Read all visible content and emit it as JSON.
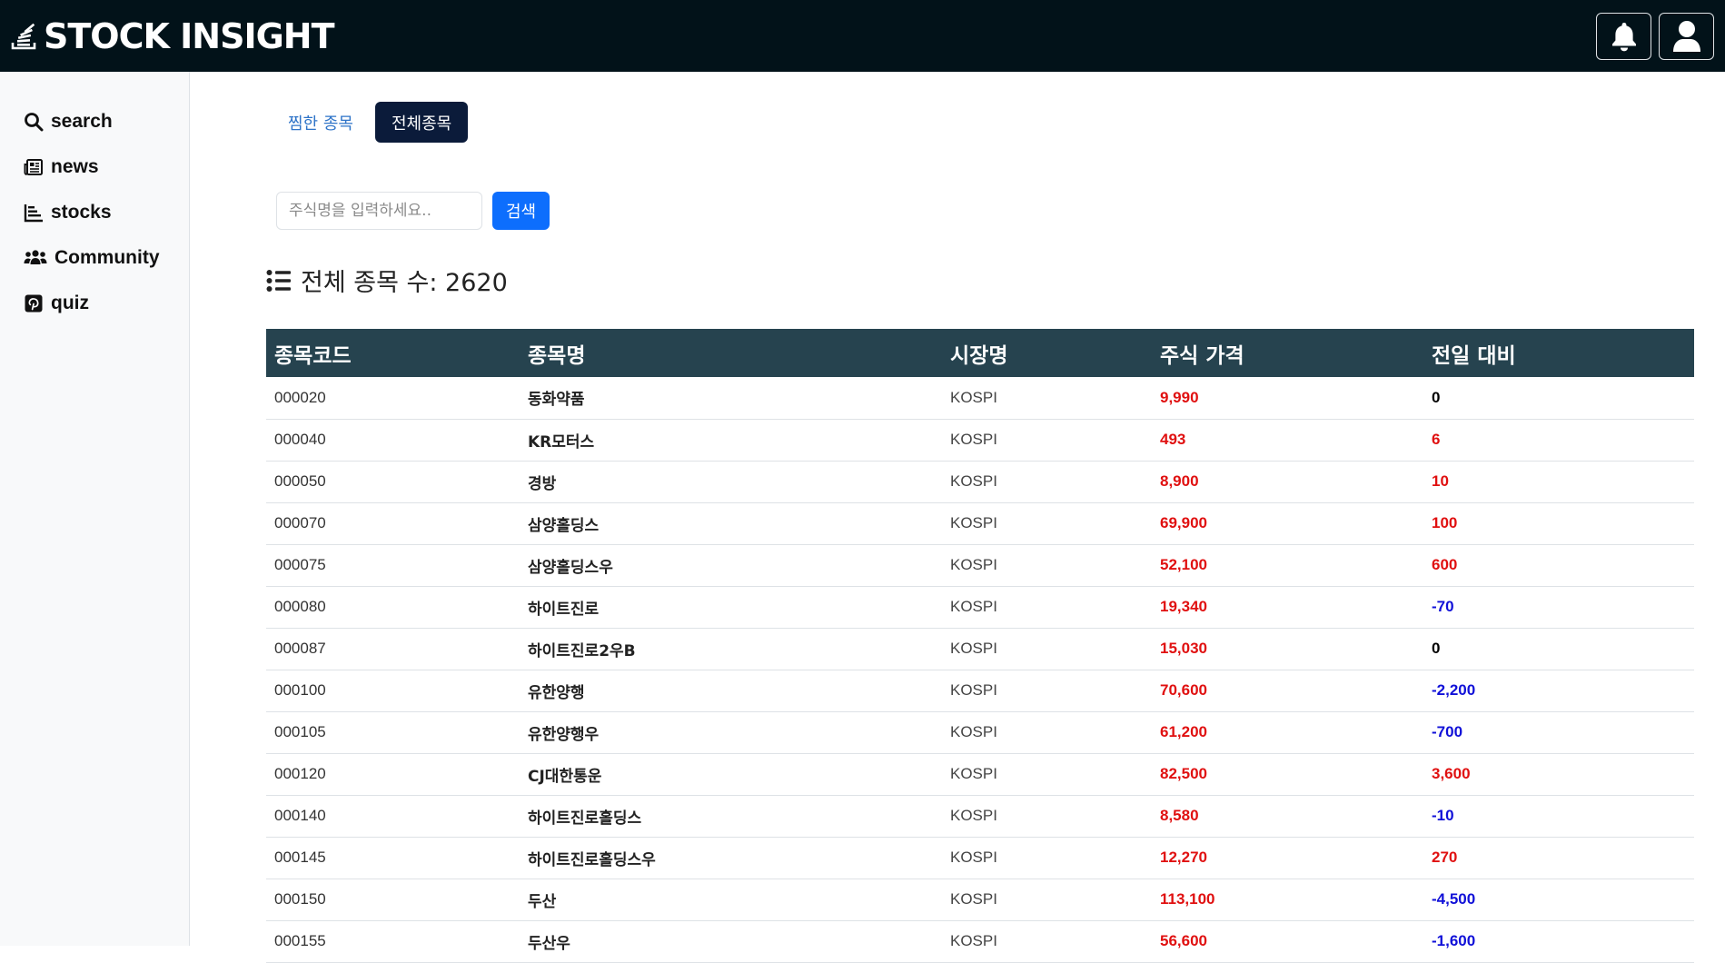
{
  "header": {
    "brand": "STOCK INSIGHT",
    "bell_icon": "bell-icon",
    "user_icon": "user-icon"
  },
  "sidebar": {
    "items": [
      {
        "label": "search",
        "icon": "search-icon"
      },
      {
        "label": "news",
        "icon": "newspaper-icon"
      },
      {
        "label": "stocks",
        "icon": "chart-icon"
      },
      {
        "label": "Community",
        "icon": "users-icon"
      },
      {
        "label": "quiz",
        "icon": "pinterest-icon"
      }
    ]
  },
  "main": {
    "tabs": [
      {
        "label": "찜한 종목",
        "active": false
      },
      {
        "label": "전체종목",
        "active": true
      }
    ],
    "search": {
      "placeholder": "주식명을 입력하세요..",
      "button_label": "검색"
    },
    "count_label": "전체 종목 수: 2620"
  },
  "table": {
    "headers": [
      "종목코드",
      "종목명",
      "시장명",
      "주식 가격",
      "전일 대비"
    ],
    "rows": [
      {
        "code": "000020",
        "name": "동화약품",
        "market": "KOSPI",
        "price": "9,990",
        "change": "0",
        "trend": "flat"
      },
      {
        "code": "000040",
        "name": "KR모터스",
        "market": "KOSPI",
        "price": "493",
        "change": "6",
        "trend": "up"
      },
      {
        "code": "000050",
        "name": "경방",
        "market": "KOSPI",
        "price": "8,900",
        "change": "10",
        "trend": "up"
      },
      {
        "code": "000070",
        "name": "삼양홀딩스",
        "market": "KOSPI",
        "price": "69,900",
        "change": "100",
        "trend": "up"
      },
      {
        "code": "000075",
        "name": "삼양홀딩스우",
        "market": "KOSPI",
        "price": "52,100",
        "change": "600",
        "trend": "up"
      },
      {
        "code": "000080",
        "name": "하이트진로",
        "market": "KOSPI",
        "price": "19,340",
        "change": "-70",
        "trend": "down"
      },
      {
        "code": "000087",
        "name": "하이트진로2우B",
        "market": "KOSPI",
        "price": "15,030",
        "change": "0",
        "trend": "flat"
      },
      {
        "code": "000100",
        "name": "유한양행",
        "market": "KOSPI",
        "price": "70,600",
        "change": "-2,200",
        "trend": "down"
      },
      {
        "code": "000105",
        "name": "유한양행우",
        "market": "KOSPI",
        "price": "61,200",
        "change": "-700",
        "trend": "down"
      },
      {
        "code": "000120",
        "name": "CJ대한통운",
        "market": "KOSPI",
        "price": "82,500",
        "change": "3,600",
        "trend": "up"
      },
      {
        "code": "000140",
        "name": "하이트진로홀딩스",
        "market": "KOSPI",
        "price": "8,580",
        "change": "-10",
        "trend": "down"
      },
      {
        "code": "000145",
        "name": "하이트진로홀딩스우",
        "market": "KOSPI",
        "price": "12,270",
        "change": "270",
        "trend": "up"
      },
      {
        "code": "000150",
        "name": "두산",
        "market": "KOSPI",
        "price": "113,100",
        "change": "-4,500",
        "trend": "down"
      },
      {
        "code": "000155",
        "name": "두산우",
        "market": "KOSPI",
        "price": "56,600",
        "change": "-1,600",
        "trend": "down"
      }
    ]
  },
  "colors": {
    "header_bg": "#021219",
    "table_header_bg": "#26434f",
    "active_tab_bg": "#0b1b3a",
    "primary": "#0d6efd",
    "up": "#e01010",
    "down": "#1010d8"
  }
}
